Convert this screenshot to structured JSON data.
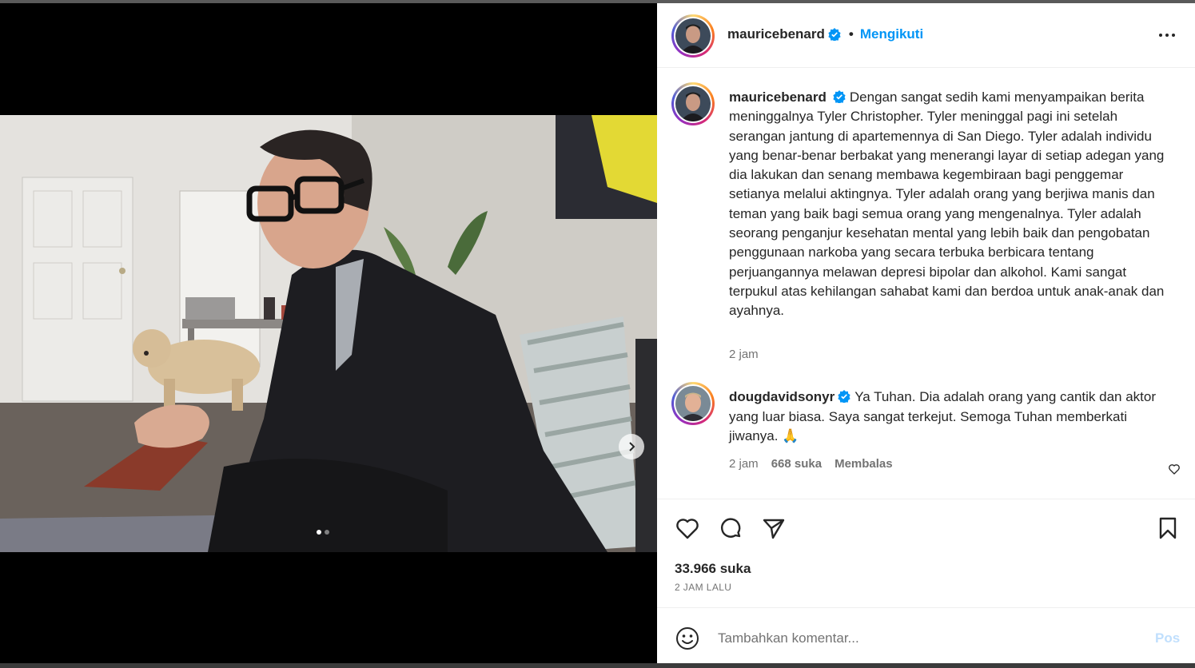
{
  "colors": {
    "accent": "#0095f6",
    "text": "#262626",
    "muted": "#737373",
    "verified": "#0095f6",
    "post_disabled": "#c0dffd"
  },
  "header": {
    "username": "mauricebenard",
    "separator": "•",
    "follow_label": "Mengikuti",
    "more_icon": "more-horizontal-icon"
  },
  "media": {
    "carousel_count": 2,
    "carousel_active": 1,
    "next_icon": "chevron-right-icon"
  },
  "caption": {
    "username": "mauricebenard",
    "text": "Dengan sangat sedih kami menyampaikan berita meninggalnya Tyler Christopher. Tyler meninggal pagi ini setelah serangan jantung di apartemennya di San Diego. Tyler adalah individu yang benar-benar berbakat yang menerangi layar di setiap adegan yang dia lakukan dan senang membawa kegembiraan bagi penggemar setianya melalui aktingnya. Tyler adalah orang yang berjiwa manis dan teman yang baik bagi semua orang yang mengenalnya. Tyler adalah seorang penganjur kesehatan mental yang lebih baik dan pengobatan penggunaan narkoba yang secara terbuka berbicara tentang perjuangannya melawan depresi bipolar dan alkohol. Kami sangat terpukul atas kehilangan sahabat kami dan berdoa untuk anak-anak dan ayahnya.",
    "time": "2 jam"
  },
  "comments": [
    {
      "username": "dougdavidsonyr",
      "text": "Ya Tuhan. Dia adalah orang yang cantik dan aktor yang luar biasa. Saya sangat terkejut. Semoga Tuhan memberkati jiwanya. 🙏",
      "time": "2 jam",
      "likes": "668 suka",
      "reply_label": "Membalas"
    }
  ],
  "actions": {
    "like_icon": "heart-icon",
    "comment_icon": "comment-icon",
    "share_icon": "share-icon",
    "save_icon": "bookmark-icon"
  },
  "stats": {
    "likes": "33.966 suka",
    "posted_ago": "2 JAM LALU"
  },
  "add_comment": {
    "placeholder": "Tambahkan komentar...",
    "post_label": "Pos",
    "emoji_icon": "emoji-icon"
  }
}
